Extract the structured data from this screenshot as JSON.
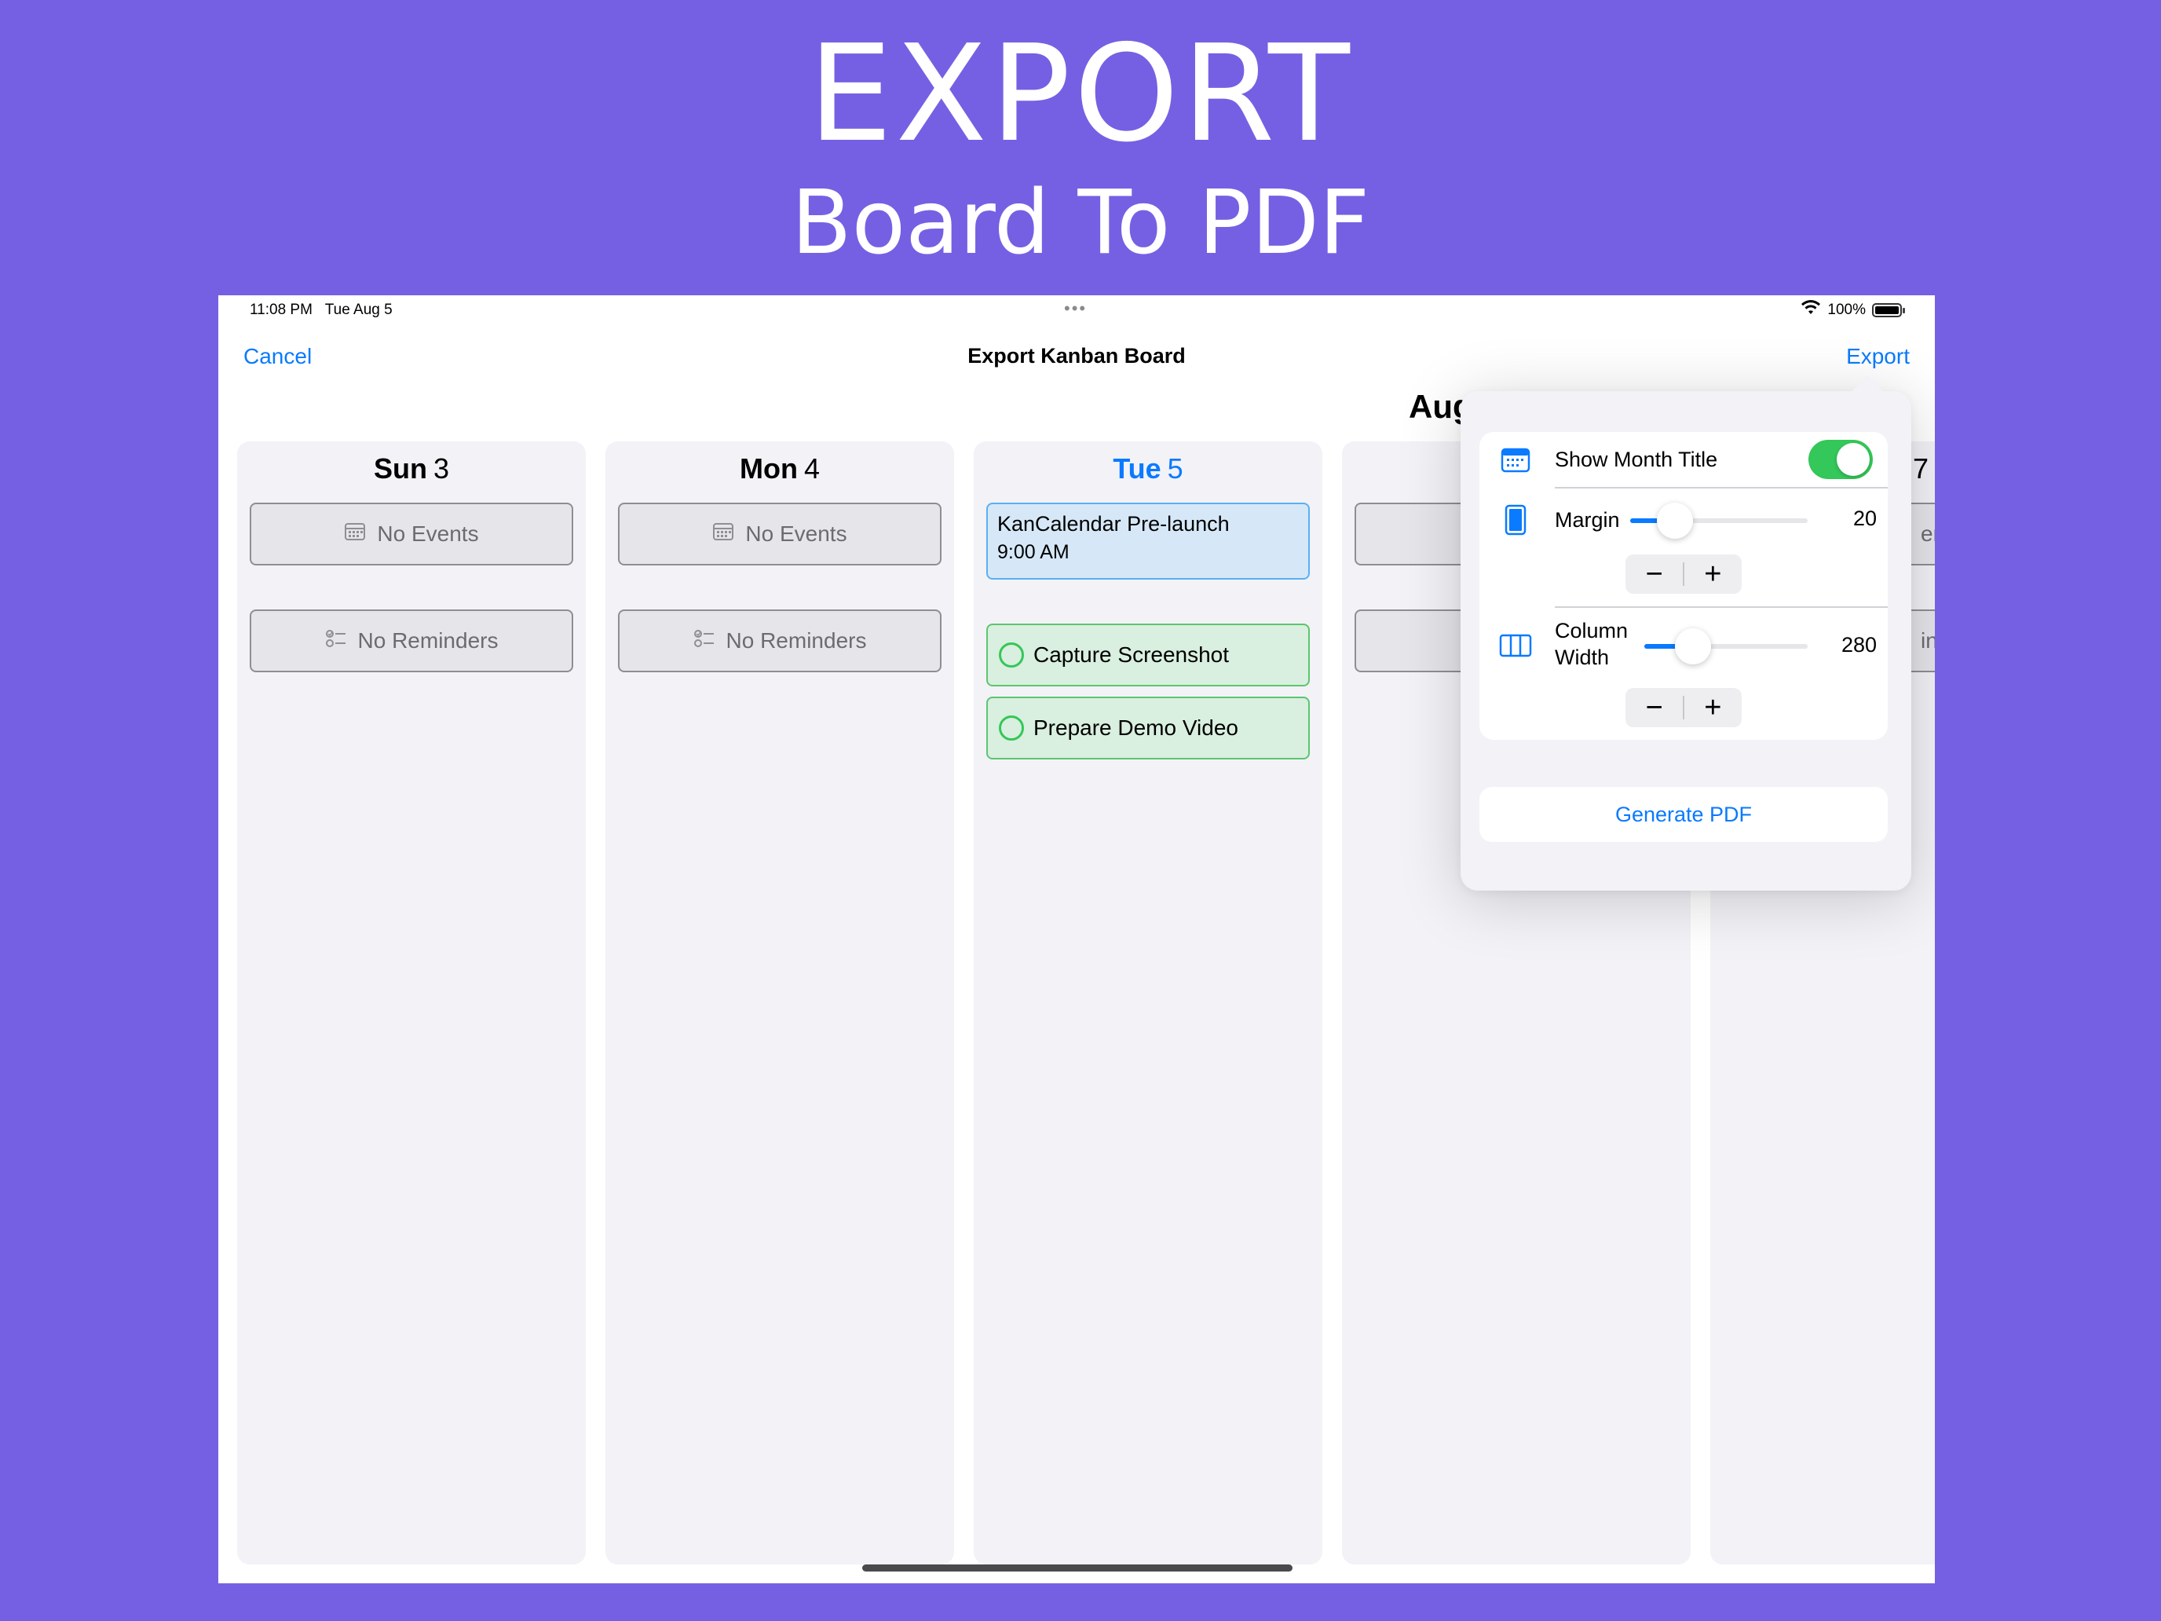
{
  "promo": {
    "headline": "EXPORT",
    "subheadline": "Board To PDF"
  },
  "status_bar": {
    "time": "11:08 PM",
    "date": "Tue Aug 5",
    "battery": "100%",
    "dots": "•••"
  },
  "nav": {
    "cancel_label": "Cancel",
    "title": "Export Kanban Board",
    "export_label": "Export"
  },
  "board": {
    "month_title": "Aug",
    "columns": [
      {
        "day_name": "Sun",
        "day_number": "3",
        "events_empty": "No Events",
        "reminders_empty": "No Reminders"
      },
      {
        "day_name": "Mon",
        "day_number": "4",
        "events_empty": "No Events",
        "reminders_empty": "No Reminders"
      },
      {
        "day_name": "Tue",
        "day_number": "5",
        "event": {
          "title": "KanCalendar Pre-launch",
          "time": "9:00 AM"
        },
        "reminders": [
          "Capture Screenshot",
          "Prepare Demo Video"
        ]
      },
      {
        "partial_label_a": "ent",
        "partial_label_b": "ind",
        "partial_day_number": "7"
      }
    ]
  },
  "popover": {
    "show_month_title": {
      "label": "Show Month Title",
      "enabled": true
    },
    "margin": {
      "label": "Margin",
      "value": "20",
      "level": 0.25
    },
    "column_width": {
      "label_line1": "Column",
      "label_line2": "Width",
      "value": "280",
      "level": 0.3
    },
    "stepper": {
      "minus": "−",
      "plus": "+"
    },
    "generate_label": "Generate PDF"
  },
  "colors": {
    "background": "#7560e4",
    "accent": "#0a7aff",
    "toggle_on": "#34c759",
    "event_bg": "#d6e8f8",
    "reminder_bg": "#d9efdf"
  },
  "icons": [
    "calendar-icon",
    "checklist-icon",
    "wifi-icon",
    "battery-icon",
    "page-icon",
    "columns-icon"
  ]
}
